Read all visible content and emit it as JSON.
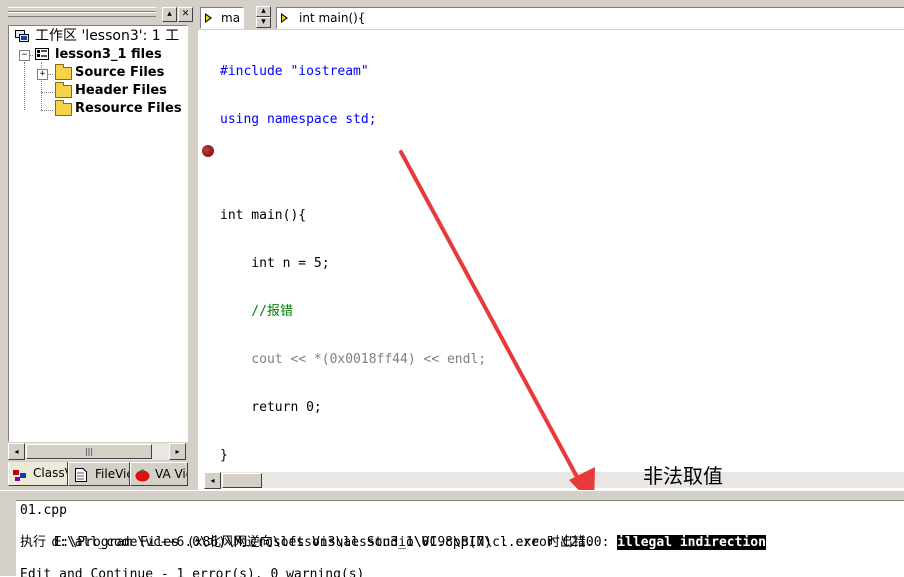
{
  "workspace": {
    "title_buttons": [
      "▴",
      "✕"
    ],
    "tree": {
      "root_label": "工作区 'lesson3': 1 工",
      "project_label": "lesson3_1 files",
      "folders": [
        {
          "label": "Source Files",
          "expander": "+"
        },
        {
          "label": "Header Files"
        },
        {
          "label": "Resource Files"
        }
      ]
    },
    "hscroll": {
      "left": "◂",
      "thumb": "|||",
      "right": "▸"
    },
    "tabs": [
      {
        "label": "ClassV"
      },
      {
        "label": "FileVie"
      },
      {
        "label": "VA Vie"
      }
    ]
  },
  "toolbar": {
    "combo1_value": "ma",
    "spin_up": "▴",
    "spin_down": "▾",
    "combo2_value": "int main(){"
  },
  "editor": {
    "code_lines": [
      "#include \"iostream\"",
      "using namespace std;",
      "",
      "int main(){",
      "    int n = 5;",
      "    //报错",
      "    cout << *(0x0018ff44) << endl;",
      "    return 0;",
      "}"
    ],
    "hscroll_left": "◂"
  },
  "annotation": {
    "label": "非法取值",
    "arrow_color": "#e83a3a"
  },
  "output": {
    "lines": [
      "01.cpp",
      "d:\\all_code\\vc++6.0\\北风网逆向\\lesson3\\lesson3_1\\01.cpp(7) : error C2100: ",
      "执行 E:\\Program Files (x86)\\Microsoft Visual Studio\\VC98\\BIN\\cl.exe 时出错.",
      "",
      "Edit and Continue - 1 error(s), 0 warning(s)"
    ],
    "highlighted_error": "illegal indirection"
  },
  "colors": {
    "keyword": "#0000ff",
    "comment": "#008000",
    "breakpoint": "#7a0000",
    "chrome": "#d4d0c8"
  }
}
